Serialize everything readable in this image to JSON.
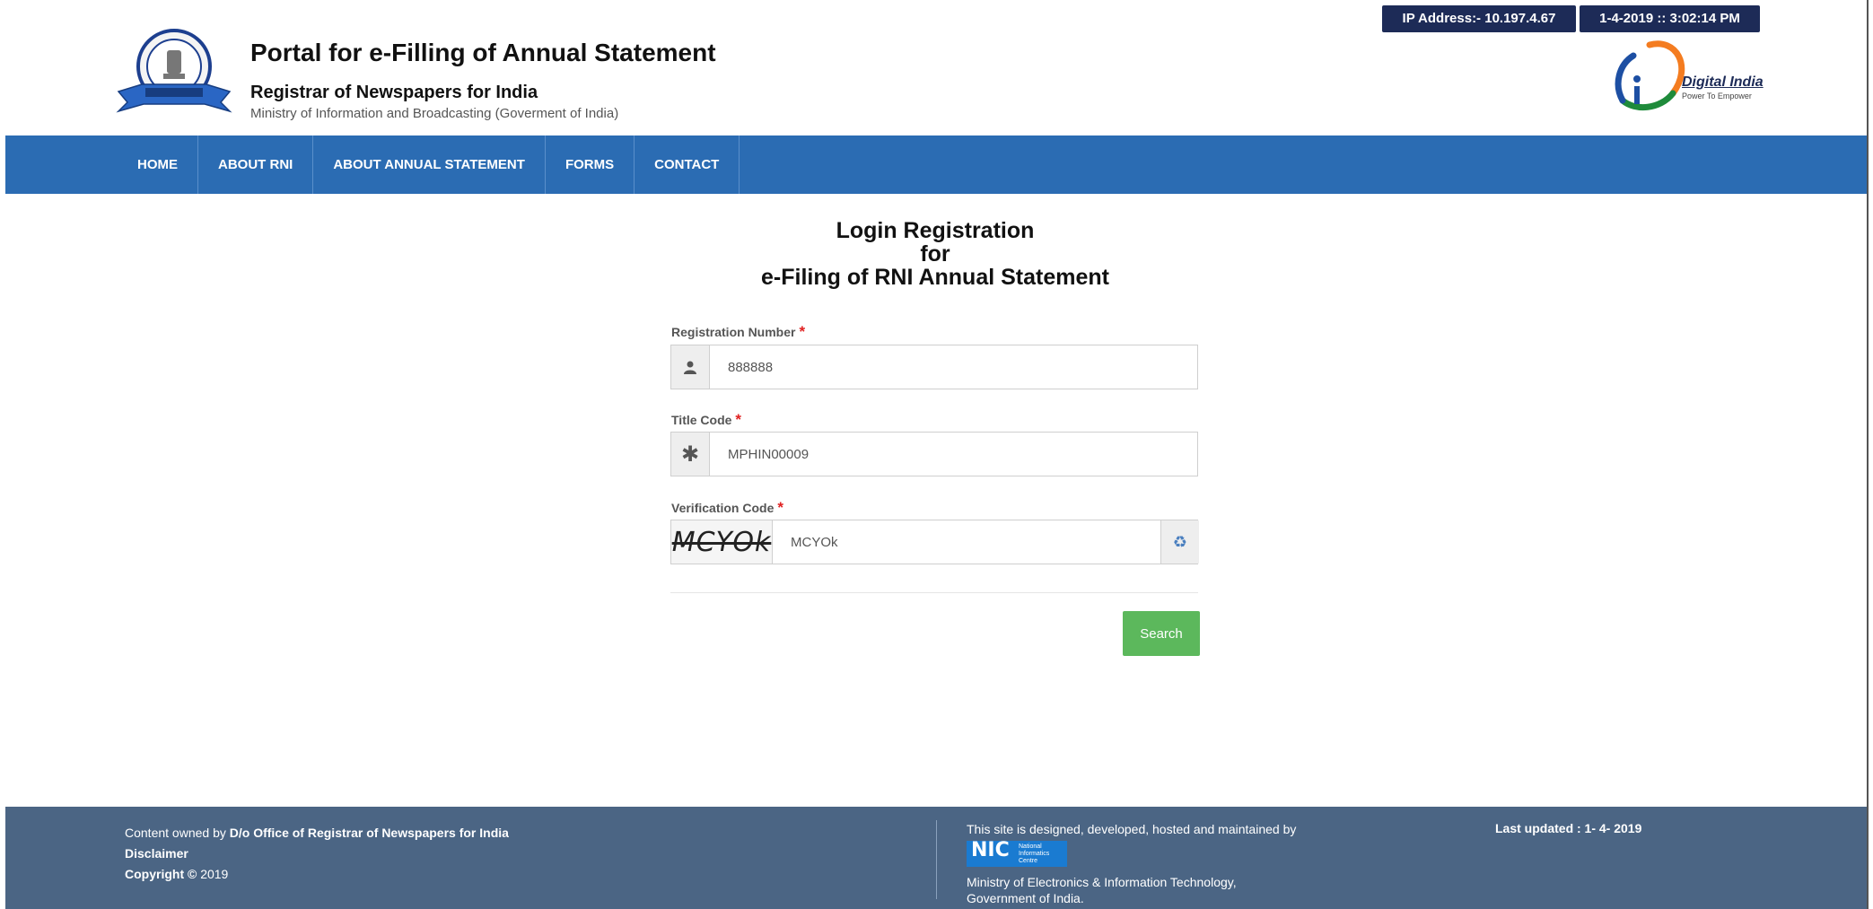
{
  "header": {
    "ip_label": "IP Address:- 10.197.4.67",
    "datetime": "1-4-2019 :: 3:02:14 PM",
    "title": "Portal for e-Filling of Annual Statement",
    "subtitle": "Registrar of Newspapers for India",
    "ministry": "Ministry of Information and Broadcasting (Goverment of India)",
    "digital_india": "Digital India",
    "digital_india_tagline": "Power To Empower"
  },
  "nav": {
    "items": [
      "HOME",
      "ABOUT RNI",
      "ABOUT ANNUAL STATEMENT",
      "FORMS",
      "CONTACT"
    ]
  },
  "form": {
    "heading_line1": "Login Registration",
    "heading_line2": "for",
    "heading_line3": "e-Filing of RNI Annual Statement",
    "registration_label": "Registration Number",
    "registration_value": "888888",
    "title_code_label": "Title Code",
    "title_code_value": "MPHIN00009",
    "verification_label": "Verification Code",
    "captcha_text": "MCYOk",
    "verification_value": "MCYOk",
    "required_mark": "*",
    "search_label": "Search"
  },
  "footer": {
    "content_owned_prefix": "Content owned by",
    "content_owner": "D/o Office of Registrar of Newspapers for India",
    "disclaimer": "Disclaimer",
    "copyright_label": "Copyright ©",
    "copyright_year": "2019",
    "designed_by": "This site is designed, developed, hosted and maintained by",
    "nic_logo": "NIC",
    "nic_logo_text": "National Informatics Centre",
    "ministry_line1": "Ministry of Electronics & Information Technology,",
    "ministry_line2": "Government of India.",
    "last_updated": "Last updated : 1- 4- 2019"
  },
  "colors": {
    "nav_bg": "#2b6cb3",
    "pill_bg": "#1d2b57",
    "footer_bg": "#4b6584",
    "search_btn": "#5cb85c",
    "required": "#e02020"
  },
  "icons": {
    "registration_addon": "user-icon",
    "title_code_addon": "asterisk-icon",
    "refresh": "refresh-icon"
  }
}
